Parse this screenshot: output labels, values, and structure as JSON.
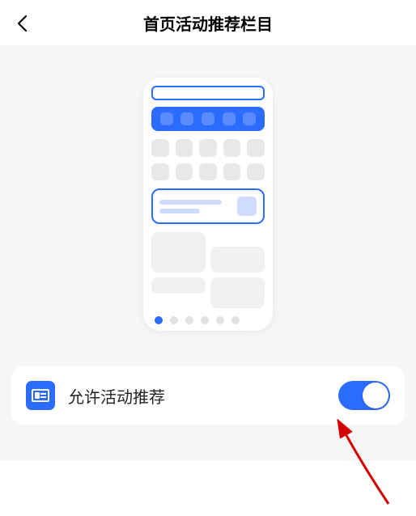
{
  "header": {
    "title": "首页活动推荐栏目",
    "back_icon": "chevron-left"
  },
  "preview": {
    "page_dots": 6,
    "active_dot": 0
  },
  "setting": {
    "icon": "card-icon",
    "label": "允许活动推荐",
    "toggle_on": true
  },
  "colors": {
    "accent": "#2b6cff"
  }
}
